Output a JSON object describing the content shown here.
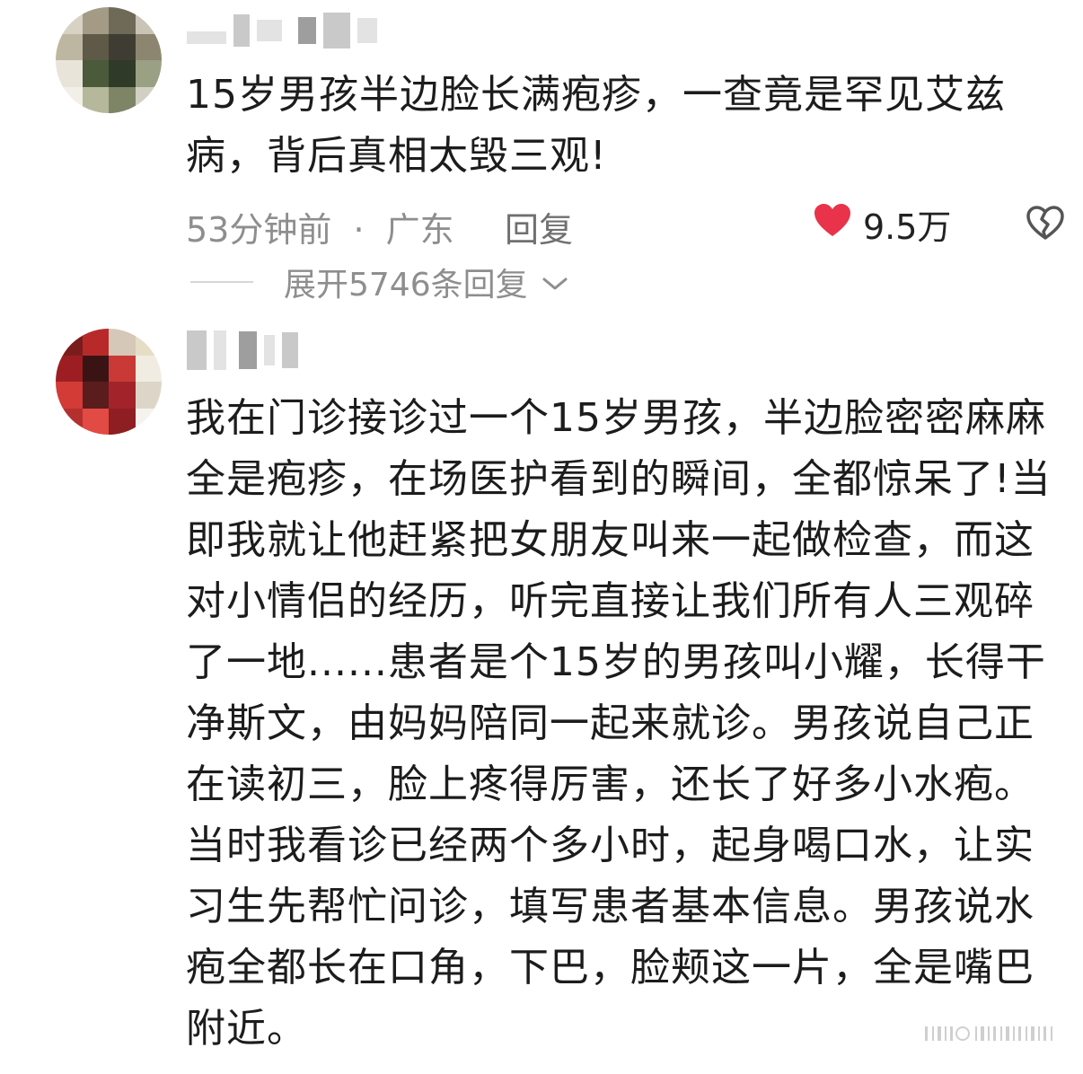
{
  "comments": [
    {
      "username": "",
      "text": "15岁男孩半边脸长满疱疹，一查竟是罕见艾兹病，背后真相太毁三观!",
      "time": "53分钟前",
      "location": "广东",
      "reply_label": "回复",
      "likes": "9.5万",
      "expand_label": "展开5746条回复"
    },
    {
      "username": "",
      "text": "我在门诊接诊过一个15岁男孩，半边脸密密麻麻全是疱疹，在场医护看到的瞬间，全都惊呆了!当即我就让他赶紧把女朋友叫来一起做检查，而这对小情侣的经历，听完直接让我们所有人三观碎了一地......患者是个15岁的男孩叫小耀，长得干净斯文，由妈妈陪同一起来就诊。男孩说自己正在读初三，脸上疼得厉害，还长了好多小水疱。当时我看诊已经两个多小时，起身喝口水，让实习生先帮忙问诊，填写患者基本信息。男孩说水疱全都长在口角，下巴，脸颊这一片，全是嘴巴附近。"
    }
  ],
  "meta_separator": "·",
  "colors": {
    "heart": "#e8334a",
    "meta": "#8e8e8e",
    "text": "#1c1c1c"
  },
  "icons": {
    "like": "heart-icon",
    "dislike": "broken-heart-icon",
    "expand": "chevron-down-icon"
  }
}
